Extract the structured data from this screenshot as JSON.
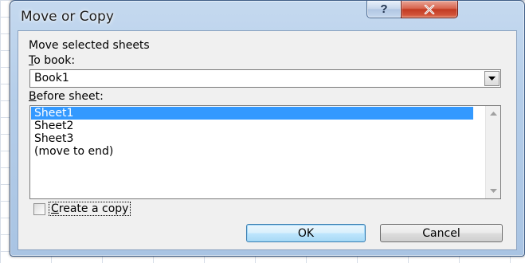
{
  "window": {
    "title": "Move or Copy",
    "help_glyph": "?",
    "close_icon": "close-x-icon",
    "close_color": "#c23b22"
  },
  "form": {
    "move_label": "Move selected sheets",
    "to_book_label_underlined": "T",
    "to_book_label_rest": "o book:",
    "to_book_value": "Book1",
    "before_sheet_label_underlined": "B",
    "before_sheet_label_rest": "efore sheet:",
    "sheets": [
      {
        "label": "Sheet1",
        "selected": true
      },
      {
        "label": "Sheet2",
        "selected": false
      },
      {
        "label": "Sheet3",
        "selected": false
      },
      {
        "label": "(move to end)",
        "selected": false
      }
    ],
    "create_copy_label_underlined": "C",
    "create_copy_label_rest": "reate a copy",
    "create_copy_checked": false
  },
  "buttons": {
    "ok_label": "OK",
    "cancel_label": "Cancel"
  },
  "colors": {
    "selection": "#3399ff",
    "frame": "#b4cde9"
  }
}
